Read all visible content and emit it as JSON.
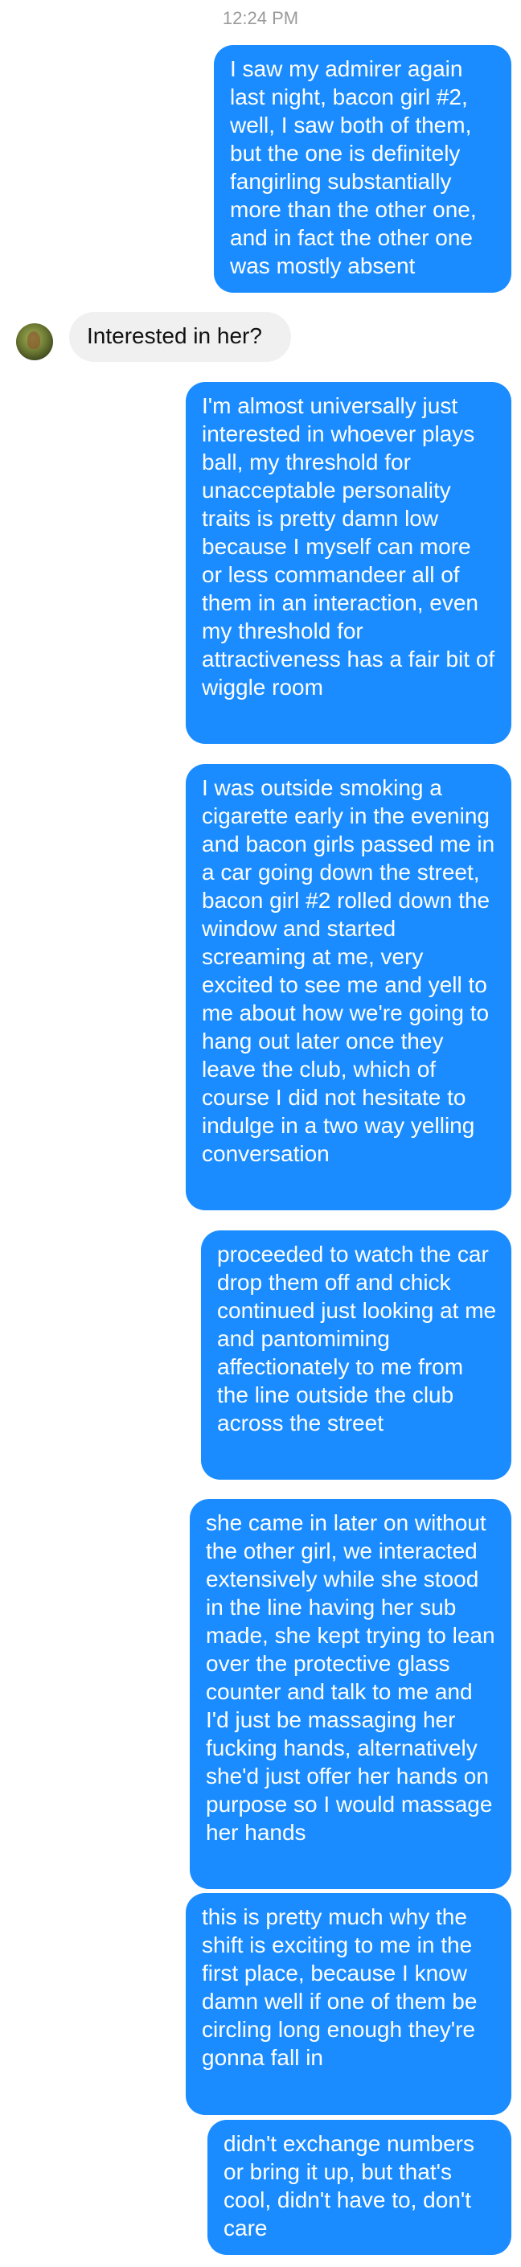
{
  "conversation": {
    "timestamp": "12:24 PM",
    "messages": [
      {
        "sender": "me",
        "text": "I saw my admirer again last night, bacon girl #2, well, I saw both of them, but the one is definitely fangirling substantially more than the other one, and in fact the other one was mostly absent"
      },
      {
        "sender": "them",
        "text": "Interested in her?"
      },
      {
        "sender": "me",
        "text": "I'm almost universally just interested in whoever plays ball, my threshold for unacceptable personality traits is pretty damn low because I myself can more or less commandeer all of them in an interaction, even my threshold for attractiveness has a fair bit of wiggle room"
      },
      {
        "sender": "me",
        "text": "I was outside smoking a cigarette early in the evening and bacon girls passed me in a car going down the street, bacon girl #2 rolled down the window and started screaming at me, very excited to see me and yell to me about how we're going to hang out later once they leave the club, which of course I did not hesitate to indulge in a two way yelling conversation"
      },
      {
        "sender": "me",
        "text": "proceeded to watch the car drop them off and chick continued just looking at me and pantomiming affectionately to me from the line outside the club across the street"
      },
      {
        "sender": "me",
        "text": "she came in later on without the other girl, we interacted extensively while she stood in the line having her sub made, she kept trying to lean over the protective glass counter and talk to me and I'd just be massaging her fucking hands, alternatively she'd just offer her hands on purpose so I would massage her hands"
      },
      {
        "sender": "me",
        "text": "this is pretty much why the shift is exciting to me in the first place, because I know damn well if one of them be circling long enough they're gonna fall in"
      },
      {
        "sender": "me",
        "text": "didn't exchange numbers or bring it up, but that's cool, didn't have to, don't care"
      }
    ]
  }
}
